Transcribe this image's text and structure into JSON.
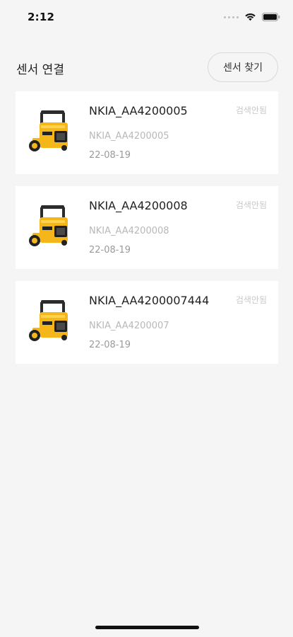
{
  "status_bar": {
    "time": "2:12"
  },
  "header": {
    "title": "센서 연결",
    "find_button_label": "센서 찾기"
  },
  "sensors": [
    {
      "name": "NKIA_AA4200005",
      "serial": "NKIA_AA4200005",
      "date": "22-08-19",
      "status": "검색안됨"
    },
    {
      "name": "NKIA_AA4200008",
      "serial": "NKIA_AA4200008",
      "date": "22-08-19",
      "status": "검색안됨"
    },
    {
      "name": "NKIA_AA4200007444",
      "serial": "NKIA_AA4200007",
      "date": "22-08-19",
      "status": "검색안됨"
    }
  ],
  "colors": {
    "background": "#f5f5f5",
    "card": "#ffffff",
    "device_yellow": "#f4b619",
    "status_text": "#c8c8c8"
  },
  "icons": {
    "wifi": "wifi-icon",
    "battery": "battery-icon",
    "signal": "cellular-signal-icon",
    "device": "sensor-device-image"
  }
}
